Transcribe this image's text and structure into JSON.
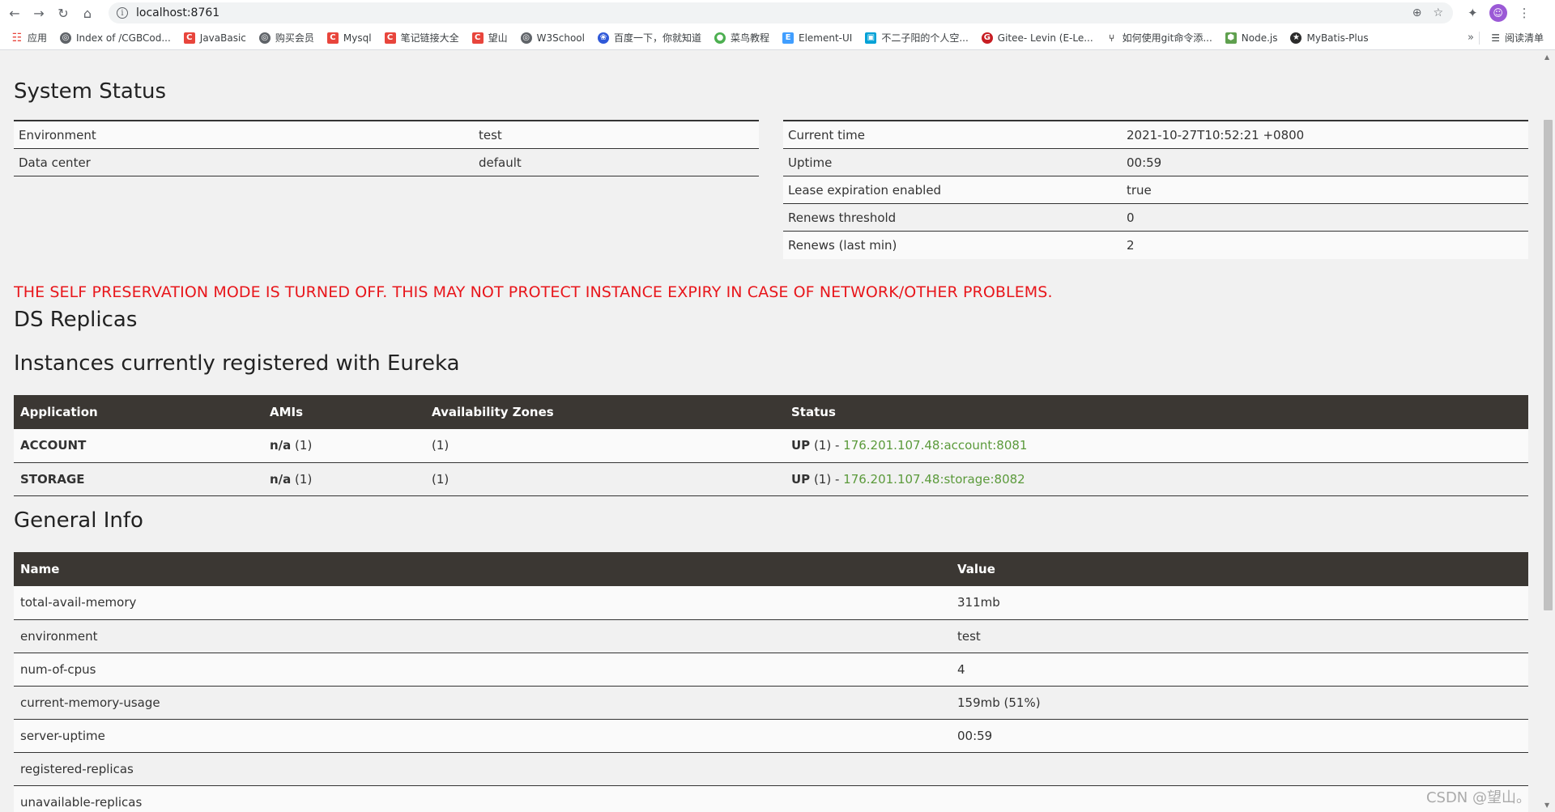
{
  "browser": {
    "url": "localhost:8761",
    "bookmarks": [
      {
        "label": "应用",
        "icon": "apps-grid-icon"
      },
      {
        "label": "Index of /CGBCod...",
        "icon": "globe-icon"
      },
      {
        "label": "JavaBasic",
        "icon": "csdn-icon"
      },
      {
        "label": "购买会员",
        "icon": "globe-icon"
      },
      {
        "label": "Mysql",
        "icon": "csdn-icon"
      },
      {
        "label": "笔记链接大全",
        "icon": "csdn-icon"
      },
      {
        "label": "望山",
        "icon": "csdn-icon"
      },
      {
        "label": "W3School",
        "icon": "globe-icon"
      },
      {
        "label": "百度一下，你就知道",
        "icon": "baidu-icon"
      },
      {
        "label": "菜鸟教程",
        "icon": "runoob-icon"
      },
      {
        "label": "Element-UI",
        "icon": "element-icon"
      },
      {
        "label": "不二子阳的个人空...",
        "icon": "bilibili-icon"
      },
      {
        "label": "Gitee- Levin (E-Le...",
        "icon": "gitee-icon"
      },
      {
        "label": "如何使用git命令添...",
        "icon": "git-icon"
      },
      {
        "label": "Node.js",
        "icon": "nodejs-icon"
      },
      {
        "label": "MyBatis-Plus",
        "icon": "mybatis-icon"
      }
    ],
    "reading_list": "阅读清单"
  },
  "system_status": {
    "title": "System Status",
    "left": [
      {
        "key": "Environment",
        "value": "test"
      },
      {
        "key": "Data center",
        "value": "default"
      }
    ],
    "right": [
      {
        "key": "Current time",
        "value": "2021-10-27T10:52:21 +0800"
      },
      {
        "key": "Uptime",
        "value": "00:59"
      },
      {
        "key": "Lease expiration enabled",
        "value": "true"
      },
      {
        "key": "Renews threshold",
        "value": "0"
      },
      {
        "key": "Renews (last min)",
        "value": "2"
      }
    ]
  },
  "warning": "THE SELF PRESERVATION MODE IS TURNED OFF. THIS MAY NOT PROTECT INSTANCE EXPIRY IN CASE OF NETWORK/OTHER PROBLEMS.",
  "ds_replicas": {
    "title": "DS Replicas"
  },
  "instances": {
    "title": "Instances currently registered with Eureka",
    "headers": [
      "Application",
      "AMIs",
      "Availability Zones",
      "Status"
    ],
    "rows": [
      {
        "app": "ACCOUNT",
        "amis_bold": "n/a",
        "amis_count": " (1)",
        "zones": "(1)",
        "status_bold": "UP",
        "status_count": " (1) - ",
        "link": "176.201.107.48:account:8081"
      },
      {
        "app": "STORAGE",
        "amis_bold": "n/a",
        "amis_count": " (1)",
        "zones": "(1)",
        "status_bold": "UP",
        "status_count": " (1) - ",
        "link": "176.201.107.48:storage:8082"
      }
    ]
  },
  "general_info": {
    "title": "General Info",
    "headers": [
      "Name",
      "Value"
    ],
    "rows": [
      {
        "name": "total-avail-memory",
        "value": "311mb"
      },
      {
        "name": "environment",
        "value": "test"
      },
      {
        "name": "num-of-cpus",
        "value": "4"
      },
      {
        "name": "current-memory-usage",
        "value": "159mb (51%)"
      },
      {
        "name": "server-uptime",
        "value": "00:59"
      },
      {
        "name": "registered-replicas",
        "value": ""
      },
      {
        "name": "unavailable-replicas",
        "value": ""
      }
    ]
  },
  "watermark": "CSDN @望山。",
  "colors": {
    "warning": "#e8161b",
    "header_bg": "#3b3733",
    "link": "#5b9a3b"
  }
}
